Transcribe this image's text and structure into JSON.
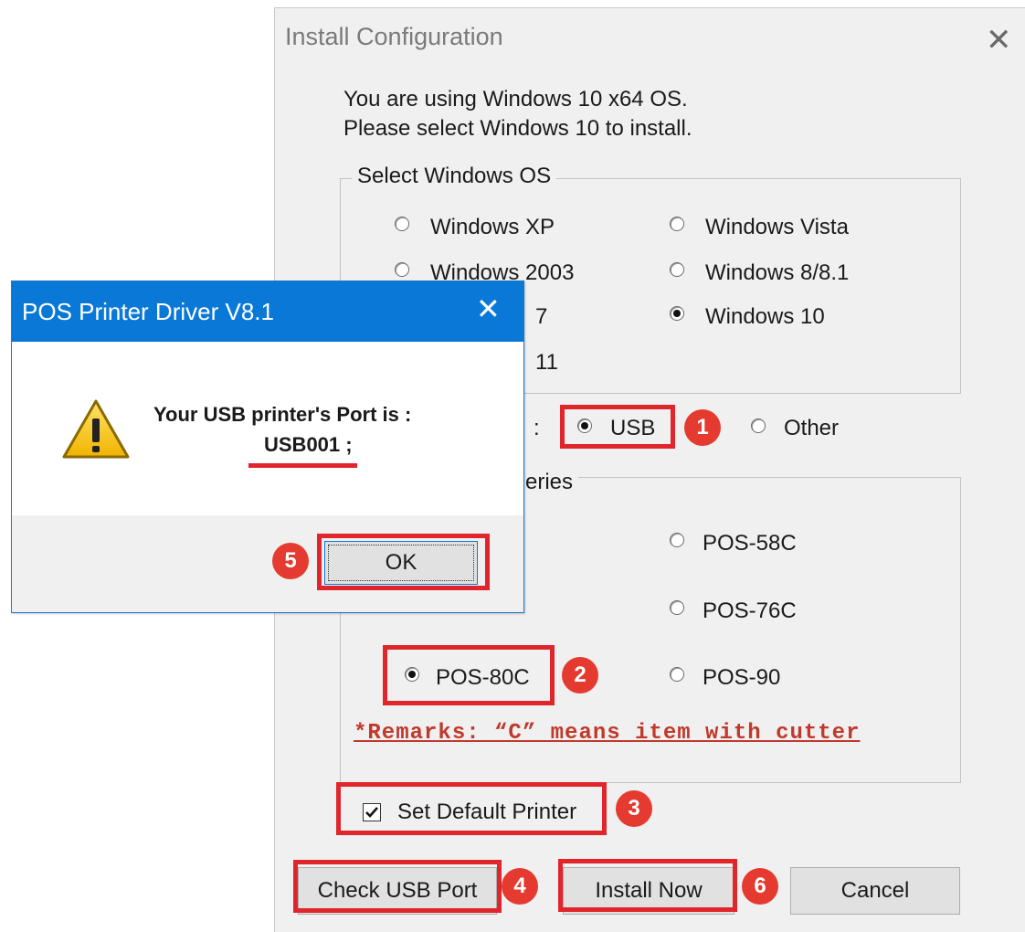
{
  "install_window": {
    "title": "Install Configuration",
    "close_glyph": "✕",
    "intro_line1": "You are using Windows 10 x64 OS.",
    "intro_line2": "Please select Windows 10 to install.",
    "os_group": {
      "legend": "Select Windows OS",
      "options": [
        {
          "label": "Windows XP",
          "selected": false
        },
        {
          "label": "Windows Vista",
          "selected": false
        },
        {
          "label": "Windows 2003",
          "selected": false
        },
        {
          "label": "Windows 8/8.1",
          "selected": false
        },
        {
          "label": "7",
          "selected": false
        },
        {
          "label": "Windows 10",
          "selected": true
        },
        {
          "label": "11",
          "selected": false
        }
      ]
    },
    "port_group": {
      "colon": ":",
      "options": [
        {
          "label": "USB",
          "selected": true
        },
        {
          "label": "Other",
          "selected": false
        }
      ]
    },
    "series_group": {
      "legend_partial": "eries",
      "options": [
        {
          "label": "POS-58C",
          "selected": false
        },
        {
          "label": "POS-76C",
          "selected": false
        },
        {
          "label": "POS-80C",
          "selected": true
        },
        {
          "label": "POS-90",
          "selected": false
        }
      ],
      "remarks": "*Remarks: “C” means item with cutter"
    },
    "set_default_printer": {
      "label": "Set Default Printer",
      "checked": true
    },
    "buttons": {
      "check_usb_port": "Check USB Port",
      "install_now": "Install Now",
      "cancel": "Cancel"
    }
  },
  "popup": {
    "title": "POS Printer Driver V8.1",
    "close_glyph": "✕",
    "message_line1": "Your USB printer's Port is :",
    "port_value": "USB001",
    "port_suffix": " ;",
    "ok_label": "OK"
  },
  "annotations": {
    "badge_usb": "1",
    "badge_pos80c": "2",
    "badge_default": "3",
    "badge_check": "4",
    "badge_ok": "5",
    "badge_install": "6",
    "highlight_color": "#e0262b",
    "badge_color": "#e53a2f"
  },
  "colors": {
    "window_bg": "#f0f0f0",
    "popup_titlebar": "#0a78d7",
    "remarks_text": "#c0392b"
  }
}
